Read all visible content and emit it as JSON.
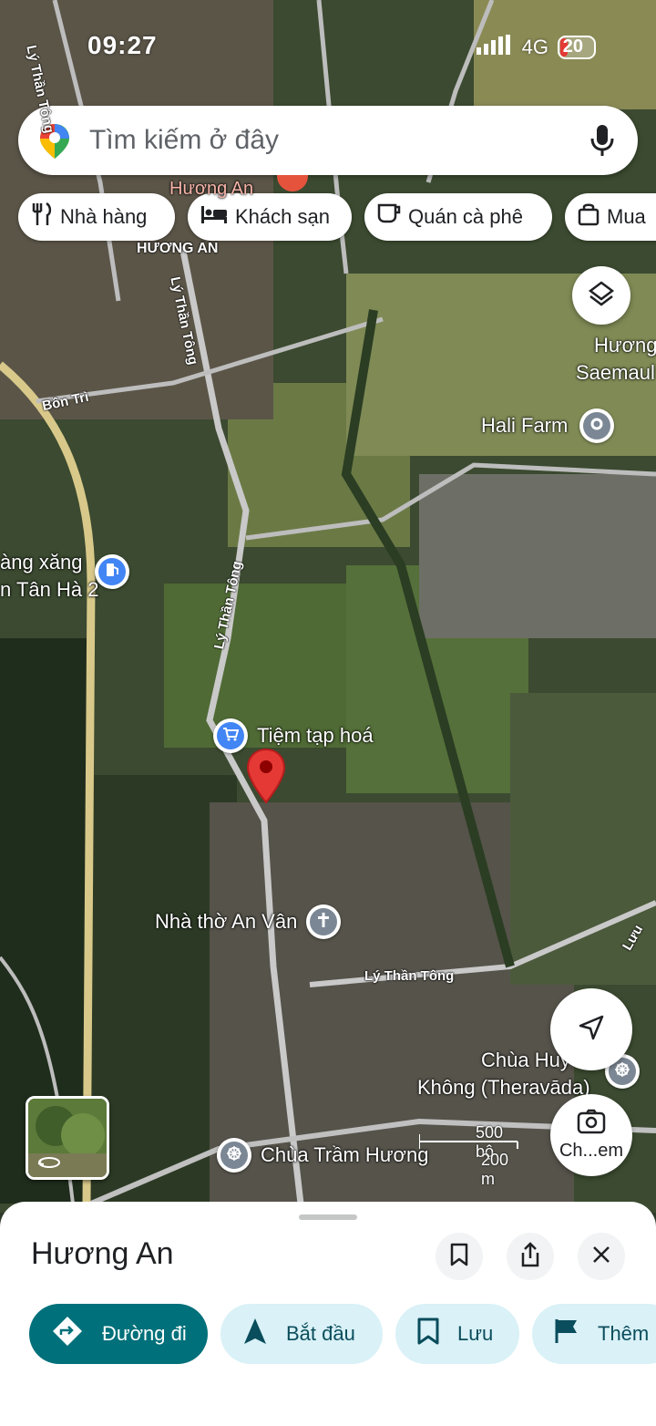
{
  "status_bar": {
    "time": "09:27",
    "network": "4G",
    "battery": "20"
  },
  "search": {
    "placeholder": "Tìm kiếm ở đây"
  },
  "chips": [
    {
      "label": "Nhà hàng",
      "icon": "restaurant-icon"
    },
    {
      "label": "Khách sạn",
      "icon": "hotel-icon"
    },
    {
      "label": "Quán cà phê",
      "icon": "coffee-icon"
    },
    {
      "label": "Mua",
      "icon": "shopping-bag-icon"
    }
  ],
  "map": {
    "place_labels": {
      "huong_an_red": "Hương An",
      "huong_an_caps": "HƯƠNG AN",
      "huong_saemaul_1": "Hương",
      "huong_saemaul_2": "Saemaul",
      "hali_farm": "Hali Farm",
      "gas_station_1": "àng xăng",
      "gas_station_2": "n Tân Hà 2",
      "grocery": "Tiệm tạp hoá",
      "church": "Nhà thờ An Vân",
      "pagoda_1": "Chùa Huy",
      "pagoda_2": "Không (Theravāda)",
      "chua_tram_huong": "Chùa Trầm Hương"
    },
    "road_labels": {
      "ly_than_tong_top": "Lý Thần Tông",
      "ly_than_tong_mid": "Lý Thần Tông",
      "ly_than_tong_center": "Lý Thần Tông",
      "ly_than_tong_lower": "Lý Thần Tông",
      "bon_tri": "Bồn Trì",
      "luu": "Lưu"
    },
    "scale": {
      "imperial": "500 bộ",
      "metric": "200 m"
    },
    "camera_label": "Ch...em"
  },
  "sheet": {
    "title": "Hương An",
    "actions": [
      {
        "label": "Đường đi",
        "icon": "directions-icon"
      },
      {
        "label": "Bắt đầu",
        "icon": "navigation-icon"
      },
      {
        "label": "Lưu",
        "icon": "bookmark-icon"
      },
      {
        "label": "Thêm",
        "icon": "flag-icon"
      }
    ]
  },
  "colors": {
    "primary_teal": "#00707a",
    "secondary_tint": "#d9f1f7",
    "pin_red": "#e53935",
    "poi_blue": "#4285f4",
    "poi_gray": "#7b8794"
  }
}
